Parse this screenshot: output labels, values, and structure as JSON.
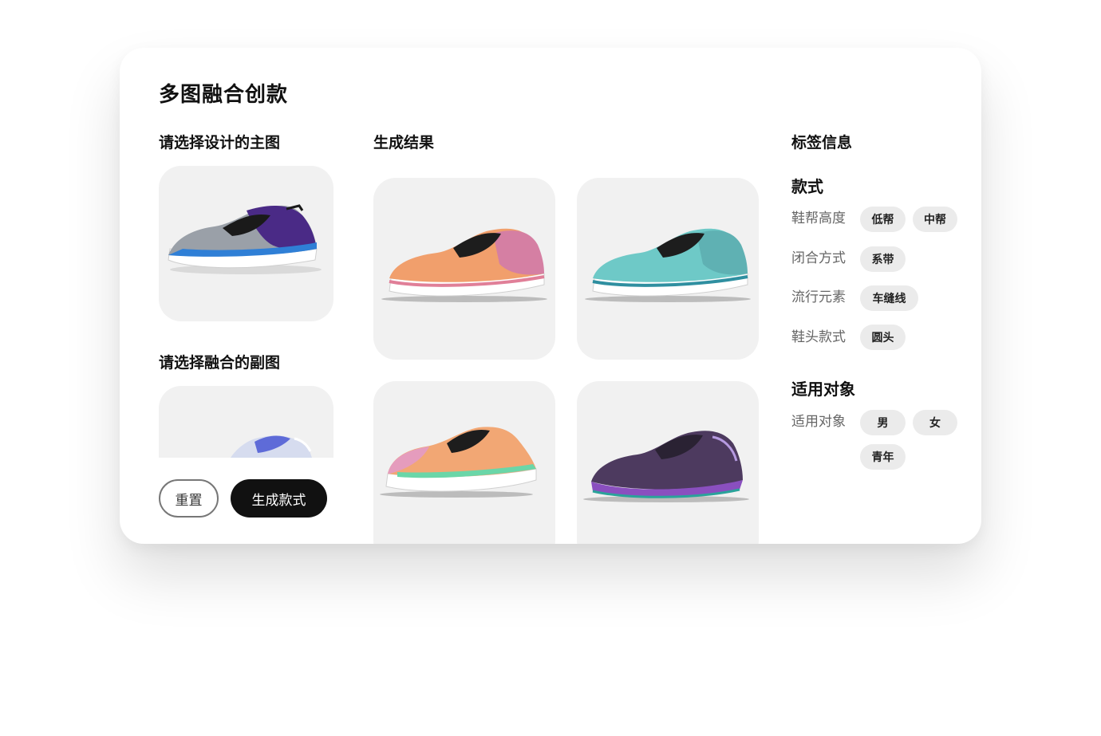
{
  "page": {
    "title": "多图融合创款"
  },
  "main_image": {
    "heading": "请选择设计的主图",
    "colors": [
      "#9aa0a8",
      "#4a2a86",
      "#2f7fd6",
      "#1a1a1a"
    ]
  },
  "secondary_image": {
    "heading": "请选择融合的副图",
    "colors": [
      "#d6dcef",
      "#5e6bd8",
      "#ffffff"
    ]
  },
  "results": {
    "heading": "生成结果",
    "items": [
      {
        "colors": [
          "#f19f6c",
          "#d57fa3",
          "#1d1d1d"
        ]
      },
      {
        "colors": [
          "#6ec9c7",
          "#2f8fa0",
          "#1d1d1d"
        ]
      },
      {
        "colors": [
          "#f2a774",
          "#6ad6a8",
          "#e59cbd"
        ]
      },
      {
        "colors": [
          "#4d3a5f",
          "#8a4fbf",
          "#2aa39a"
        ]
      }
    ]
  },
  "actions": {
    "reset_label": "重置",
    "generate_label": "生成款式"
  },
  "tags": {
    "heading": "标签信息",
    "groups": [
      {
        "title": "款式",
        "rows": [
          {
            "label": "鞋帮高度",
            "chips": [
              "低帮",
              "中帮"
            ]
          },
          {
            "label": "闭合方式",
            "chips": [
              "系带"
            ]
          },
          {
            "label": "流行元素",
            "chips": [
              "车缝线"
            ]
          },
          {
            "label": "鞋头款式",
            "chips": [
              "圆头"
            ]
          }
        ]
      },
      {
        "title": "适用对象",
        "rows": [
          {
            "label": "适用对象",
            "chips": [
              "男",
              "女",
              "青年"
            ]
          }
        ]
      }
    ]
  }
}
